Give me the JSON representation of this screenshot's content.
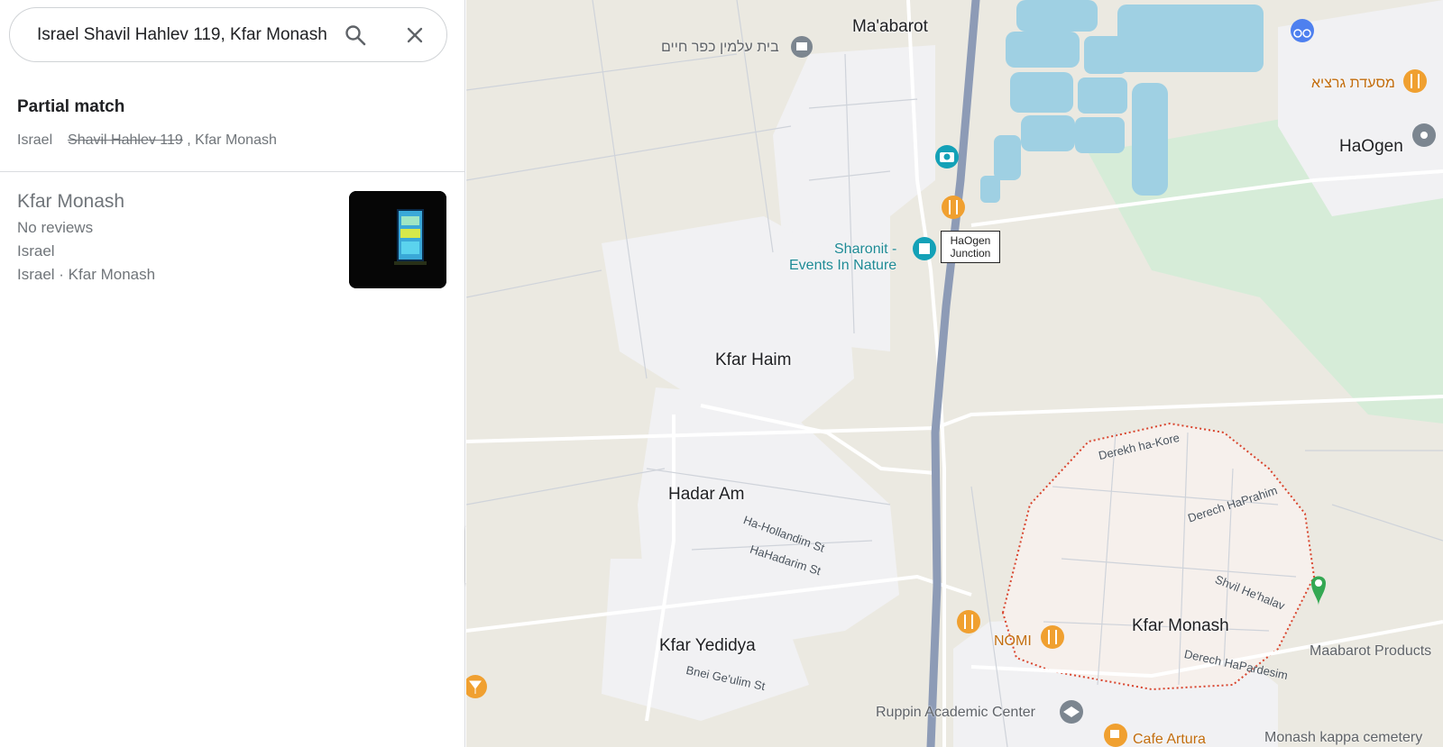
{
  "search": {
    "value": "Israel Shavil Hahlev 119, Kfar Monash",
    "search_icon": "magnifier-icon",
    "clear_icon": "close-icon"
  },
  "partial_match": {
    "title": "Partial match",
    "prefix": "Israel",
    "struck": "Shavil Hahlev 119",
    "suffix": ", Kfar Monash"
  },
  "result": {
    "name": "Kfar Monash",
    "reviews": "No reviews",
    "country": "Israel",
    "address": "Israel · Kfar Monash"
  },
  "map": {
    "places": {
      "maabarot": "Ma'abarot",
      "kfar_haim": "Kfar Haim",
      "hadar_am": "Hadar Am",
      "kfar_yedidya": "Kfar Yedidya",
      "kfar_monash": "Kfar Monash",
      "haogen": "HaOgen"
    },
    "pois": {
      "beit_almin": "בית עלמין כפר חיים",
      "sharonit": "Sharonit -",
      "sharonit_2": "Events In Nature",
      "garcia": "מסעדת גרציא",
      "nomi": "NOMI",
      "ruppin": "Ruppin Academic Center",
      "cafe_artura": "Cafe Artura",
      "monash_cemetery": "Monash kappa cemetery",
      "maabarot_products": "Maabarot Products"
    },
    "junction": {
      "line1": "HaOgen",
      "line2": "Junction"
    },
    "streets": {
      "derekh_ha_kore": "Derekh ha-Kore",
      "derech_haprahim": "Derech HaPrahim",
      "shvil_hehalav": "Shvil He'halav",
      "derech_hapardesim": "Derech HaPardesim",
      "ha_hollandim": "Ha-Hollandim St",
      "hahadarim": "HaHadarim St",
      "bnei_geulim": "Bnei Ge'ulim St"
    },
    "colors": {
      "land": "#ebe9e1",
      "urban": "#f1f1f3",
      "water": "#9fd0e3",
      "park": "#d4ecd9",
      "highway": "#8d9bb6",
      "boundary": "#d9452e"
    }
  }
}
